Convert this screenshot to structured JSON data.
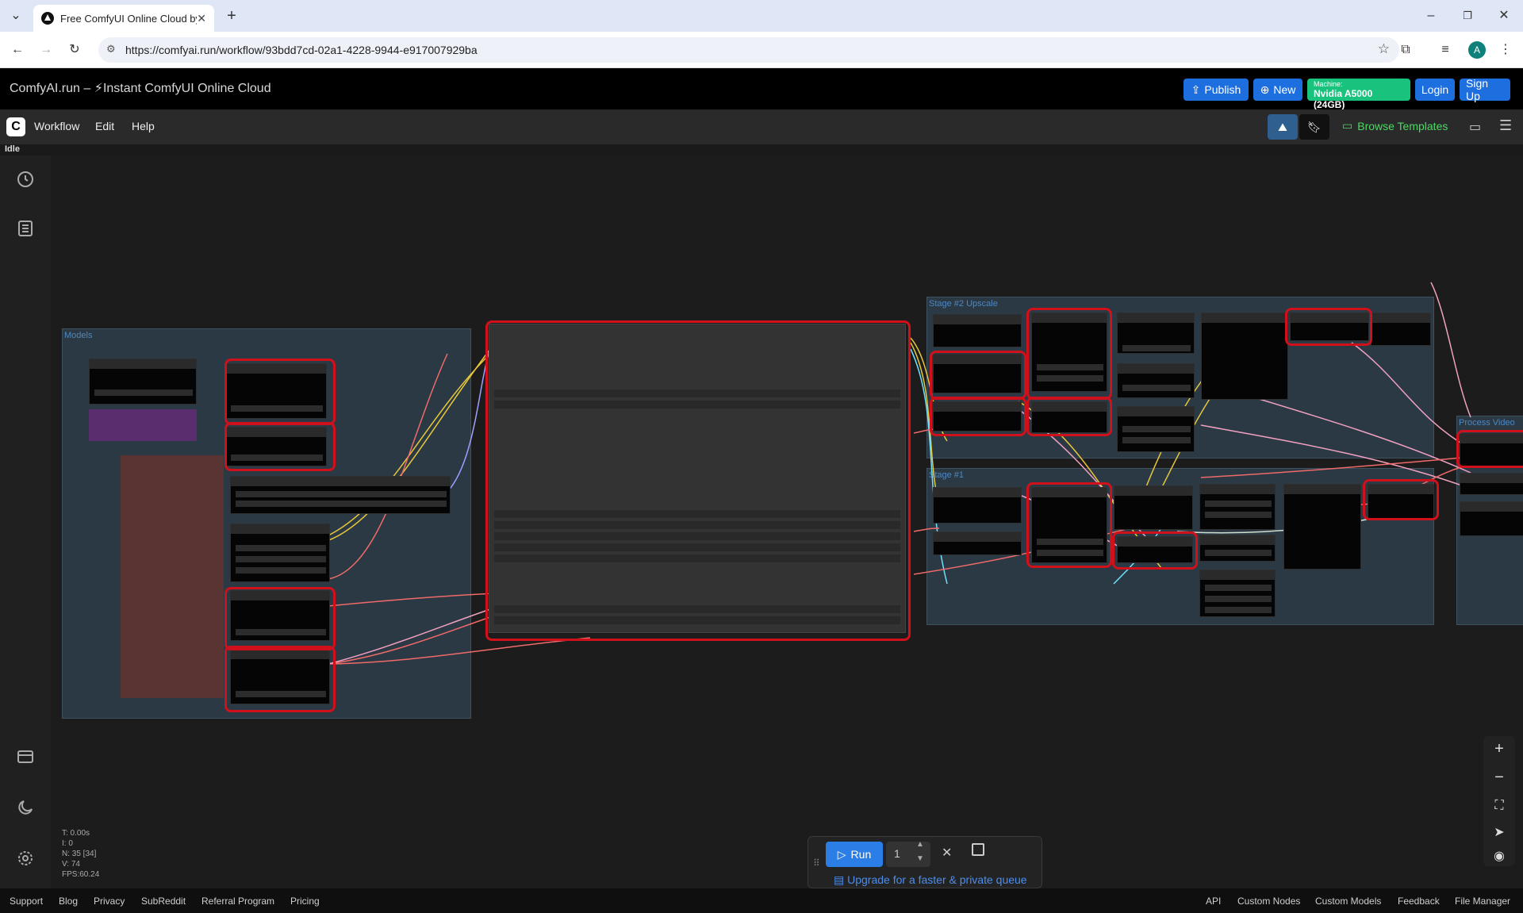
{
  "browser": {
    "tab_title": "Free ComfyUI Online Cloud by",
    "url": "https://comfyai.run/workflow/93bdd7cd-02a1-4228-9944-e917007929ba",
    "avatar_letter": "A"
  },
  "app": {
    "brand": "ComfyAI.run – ⚡Instant ComfyUI Online Cloud",
    "publish_label": "Publish",
    "new_label": "New",
    "machine_label": "Machine:",
    "machine_value": "Nvidia A5000 (24GB)",
    "login_label": "Login",
    "signup_label": "Sign Up"
  },
  "menu": {
    "workflow": "Workflow",
    "edit": "Edit",
    "help": "Help",
    "browse_templates": "Browse Templates",
    "status": "Idle"
  },
  "groups": {
    "models": "Models",
    "stage2": "Stage #2 Upscale",
    "stage1": "Stage #1",
    "process_video": "Process Video"
  },
  "stats": {
    "t": "T: 0.00s",
    "i": "I: 0",
    "n": "N: 35 [34]",
    "v": "V: 74",
    "fps": "FPS:60.24"
  },
  "run": {
    "label": "Run",
    "count": "1",
    "upgrade": "Upgrade for a faster & private queue"
  },
  "footer": {
    "support": "Support",
    "blog": "Blog",
    "privacy": "Privacy",
    "subreddit": "SubReddit",
    "referral": "Referral Program",
    "pricing": "Pricing",
    "api": "API",
    "custom_nodes": "Custom Nodes",
    "custom_models": "Custom Models",
    "feedback": "Feedback",
    "file_manager": "File Manager"
  },
  "colors": {
    "accent": "#1d6fe0",
    "machine": "#19c37d",
    "highlight": "#d0101a",
    "templates": "#4cd964"
  }
}
